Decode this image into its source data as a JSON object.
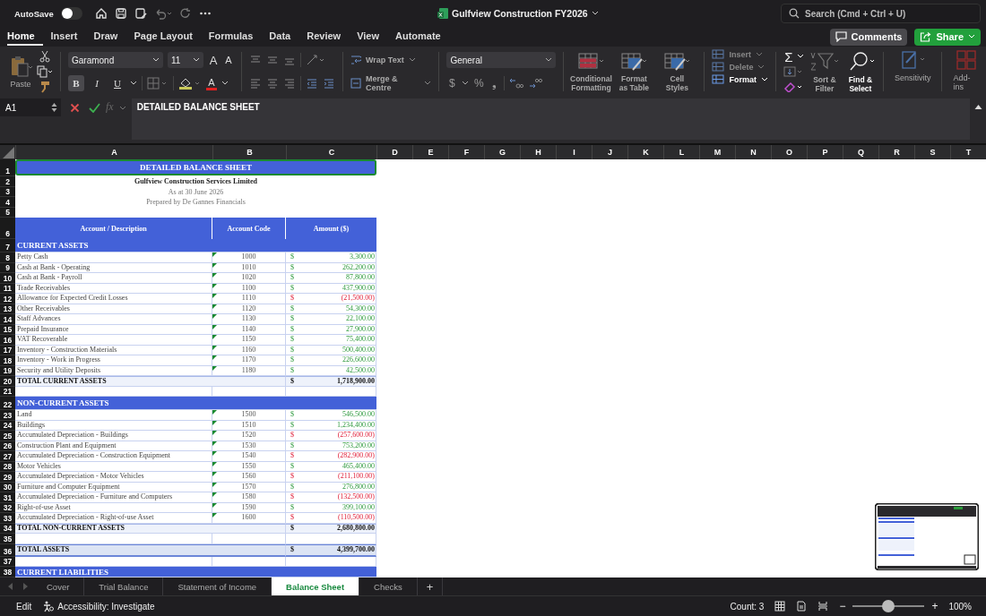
{
  "title_bar": {
    "autosave_label": "AutoSave",
    "autosave_on": false,
    "document_title": "Gulfview Construction FY2026",
    "search_placeholder": "Search (Cmd + Ctrl + U)"
  },
  "menu_tabs": [
    {
      "label": "Home",
      "selected": true
    },
    {
      "label": "Insert",
      "selected": false
    },
    {
      "label": "Draw",
      "selected": false
    },
    {
      "label": "Page Layout",
      "selected": false
    },
    {
      "label": "Formulas",
      "selected": false
    },
    {
      "label": "Data",
      "selected": false
    },
    {
      "label": "Review",
      "selected": false
    },
    {
      "label": "View",
      "selected": false
    },
    {
      "label": "Automate",
      "selected": false
    }
  ],
  "actions": {
    "comments": "Comments",
    "share": "Share"
  },
  "ribbon": {
    "paste": "Paste",
    "font_name": "Garamond",
    "font_size": "11",
    "grow_glyph": "A",
    "shrink_glyph": "A",
    "font_color_glyph": "A",
    "style_buttons": [
      {
        "glyph": "B",
        "selected": true
      },
      {
        "glyph": "I",
        "selected": false
      },
      {
        "glyph": "U",
        "selected": false
      }
    ],
    "wrap_text": "Wrap Text",
    "merge": "Merge & Centre",
    "number_format": "General",
    "currency_glyph": "$",
    "percent_glyph": "%",
    "comma_glyph": "❟",
    "style_groups": [
      {
        "lines": [
          "Conditional",
          "Formatting"
        ]
      },
      {
        "lines": [
          "Format",
          "as Table"
        ]
      },
      {
        "lines": [
          "Cell",
          "Styles"
        ]
      }
    ],
    "cells_buttons": [
      {
        "label": "Insert",
        "disabled": true
      },
      {
        "label": "Delete",
        "disabled": true
      },
      {
        "label": "Format",
        "disabled": false
      }
    ],
    "sum_glyph": "Σ",
    "sort_filter": [
      "Sort &",
      "Filter"
    ],
    "find_select": [
      "Find &",
      "Select"
    ],
    "sensitivity": "Sensitivity",
    "add_ins": "Add-ins"
  },
  "formula_bar": {
    "name_box": "A1",
    "fx_glyph": "fx",
    "formula": "DETAILED BALANCE SHEET"
  },
  "columns": [
    "A",
    "B",
    "C",
    "D",
    "E",
    "F",
    "G",
    "H",
    "I",
    "J",
    "K",
    "L",
    "M",
    "N",
    "O",
    "P",
    "Q",
    "R",
    "S",
    "T"
  ],
  "rows": [
    {
      "row_number": "1",
      "kind": "title",
      "text": "DETAILED BALANCE SHEET",
      "selected": true
    },
    {
      "row_number": "2",
      "kind": "subtitle",
      "text": "Gulfview Construction Services Limited",
      "bold": true
    },
    {
      "row_number": "3",
      "kind": "subtitle",
      "text": "As at 30 June 2026",
      "bold": false
    },
    {
      "row_number": "4",
      "kind": "subtitle",
      "text": "Prepared by De Gannes Financials",
      "bold": false
    },
    {
      "row_number": "5",
      "kind": "spacer"
    },
    {
      "row_number": "6",
      "kind": "header",
      "cells": [
        "Account / Description",
        "Account Code",
        "Amount ($)"
      ]
    },
    {
      "row_number": "7",
      "kind": "section",
      "text": "CURRENT ASSETS"
    },
    {
      "row_number": "8",
      "kind": "item",
      "description": "Petty Cash",
      "code": "1000",
      "currency": "$",
      "amount": "3,300.00",
      "negative": false
    },
    {
      "row_number": "9",
      "kind": "item",
      "description": "Cash at Bank - Operating",
      "code": "1010",
      "currency": "$",
      "amount": "262,200.00",
      "negative": false
    },
    {
      "row_number": "10",
      "kind": "item",
      "description": "Cash at Bank - Payroll",
      "code": "1020",
      "currency": "$",
      "amount": "87,800.00",
      "negative": false
    },
    {
      "row_number": "11",
      "kind": "item",
      "description": "Trade Receivables",
      "code": "1100",
      "currency": "$",
      "amount": "437,900.00",
      "negative": false
    },
    {
      "row_number": "12",
      "kind": "item",
      "description": "Allowance for Expected Credit Losses",
      "code": "1110",
      "currency": "$",
      "amount": "(21,500.00)",
      "negative": true
    },
    {
      "row_number": "13",
      "kind": "item",
      "description": "Other Receivables",
      "code": "1120",
      "currency": "$",
      "amount": "54,300.00",
      "negative": false
    },
    {
      "row_number": "14",
      "kind": "item",
      "description": "Staff Advances",
      "code": "1130",
      "currency": "$",
      "amount": "22,100.00",
      "negative": false
    },
    {
      "row_number": "15",
      "kind": "item",
      "description": "Prepaid Insurance",
      "code": "1140",
      "currency": "$",
      "amount": "27,900.00",
      "negative": false
    },
    {
      "row_number": "16",
      "kind": "item",
      "description": "VAT Recoverable",
      "code": "1150",
      "currency": "$",
      "amount": "75,400.00",
      "negative": false
    },
    {
      "row_number": "17",
      "kind": "item",
      "description": "Inventory - Construction Materials",
      "code": "1160",
      "currency": "$",
      "amount": "500,400.00",
      "negative": false
    },
    {
      "row_number": "18",
      "kind": "item",
      "description": "Inventory - Work in Progress",
      "code": "1170",
      "currency": "$",
      "amount": "226,600.00",
      "negative": false
    },
    {
      "row_number": "19",
      "kind": "item",
      "description": "Security and Utility Deposits",
      "code": "1180",
      "currency": "$",
      "amount": "42,500.00",
      "negative": false
    },
    {
      "row_number": "20",
      "kind": "total",
      "description": "TOTAL CURRENT ASSETS",
      "currency": "$",
      "amount": "1,718,900.00"
    },
    {
      "row_number": "21",
      "kind": "blank"
    },
    {
      "row_number": "22",
      "kind": "section",
      "text": "NON-CURRENT ASSETS"
    },
    {
      "row_number": "23",
      "kind": "item",
      "description": "Land",
      "code": "1500",
      "currency": "$",
      "amount": "546,500.00",
      "negative": false
    },
    {
      "row_number": "24",
      "kind": "item",
      "description": "Buildings",
      "code": "1510",
      "currency": "$",
      "amount": "1,234,400.00",
      "negative": false
    },
    {
      "row_number": "25",
      "kind": "item",
      "description": "Accumulated Depreciation - Buildings",
      "code": "1520",
      "currency": "$",
      "amount": "(257,600.00)",
      "negative": true
    },
    {
      "row_number": "26",
      "kind": "item",
      "description": "Construction Plant and Equipment",
      "code": "1530",
      "currency": "$",
      "amount": "753,200.00",
      "negative": false
    },
    {
      "row_number": "27",
      "kind": "item",
      "description": "Accumulated Depreciation - Construction Equipment",
      "code": "1540",
      "currency": "$",
      "amount": "(282,900.00)",
      "negative": true
    },
    {
      "row_number": "28",
      "kind": "item",
      "description": "Motor Vehicles",
      "code": "1550",
      "currency": "$",
      "amount": "465,400.00",
      "negative": false
    },
    {
      "row_number": "29",
      "kind": "item",
      "description": "Accumulated Depreciation - Motor Vehicles",
      "code": "1560",
      "currency": "$",
      "amount": "(211,100.00)",
      "negative": true
    },
    {
      "row_number": "30",
      "kind": "item",
      "description": "Furniture and Computer Equipment",
      "code": "1570",
      "currency": "$",
      "amount": "276,800.00",
      "negative": false
    },
    {
      "row_number": "31",
      "kind": "item",
      "description": "Accumulated Depreciation - Furniture and Computers",
      "code": "1580",
      "currency": "$",
      "amount": "(132,500.00)",
      "negative": true
    },
    {
      "row_number": "32",
      "kind": "item",
      "description": "Right-of-use Asset",
      "code": "1590",
      "currency": "$",
      "amount": "399,100.00",
      "negative": false
    },
    {
      "row_number": "33",
      "kind": "item",
      "description": "Accumulated Depreciation - Right-of-use Asset",
      "code": "1600",
      "currency": "$",
      "amount": "(110,500.00)",
      "negative": true
    },
    {
      "row_number": "34",
      "kind": "total",
      "description": "TOTAL NON-CURRENT ASSETS",
      "currency": "$",
      "amount": "2,680,800.00"
    },
    {
      "row_number": "35",
      "kind": "blank"
    },
    {
      "row_number": "36",
      "kind": "grand_total",
      "description": "TOTAL ASSETS",
      "currency": "$",
      "amount": "4,399,700.00"
    },
    {
      "row_number": "37",
      "kind": "blank"
    },
    {
      "row_number": "38",
      "kind": "section",
      "text": "CURRENT LIABILITIES"
    }
  ],
  "sheet_tabs": [
    {
      "label": "Cover",
      "selected": false
    },
    {
      "label": "Trial Balance",
      "selected": false
    },
    {
      "label": "Statement of Income",
      "selected": false
    },
    {
      "label": "Balance Sheet",
      "selected": true
    },
    {
      "label": "Checks",
      "selected": false
    }
  ],
  "add_sheet_glyph": "+",
  "status_bar": {
    "mode": "Edit",
    "accessibility": "Accessibility: Investigate",
    "count": "Count: 3",
    "zoom_out": "−",
    "zoom_in": "+",
    "zoom": {
      "level": 0.5
    },
    "zoom_reading": "100%"
  }
}
